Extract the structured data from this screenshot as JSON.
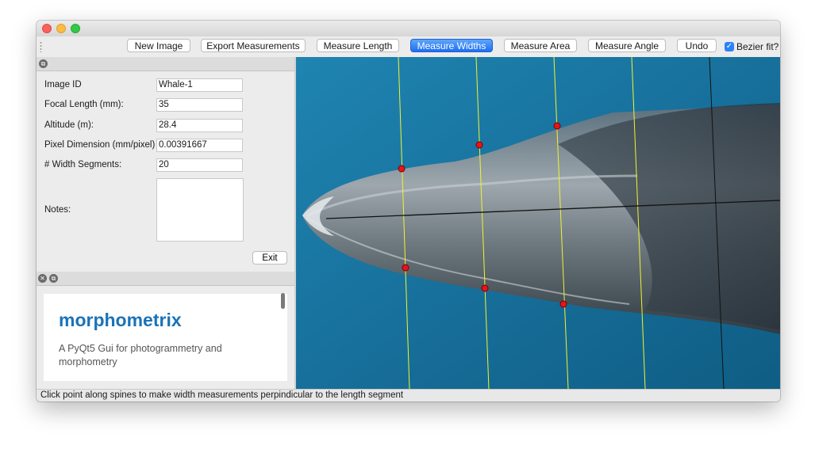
{
  "toolbar": {
    "buttons": [
      {
        "label": "New Image"
      },
      {
        "label": "Export Measurements"
      },
      {
        "label": "Measure Length"
      },
      {
        "label": "Measure Widths"
      },
      {
        "label": "Measure Area"
      },
      {
        "label": "Measure Angle"
      },
      {
        "label": "Undo"
      }
    ],
    "active_button": "Measure Widths",
    "bezier_label": "Bezier fit?",
    "bezier_checked": true
  },
  "form": {
    "image_id_label": "Image ID",
    "image_id_value": "Whale-1",
    "focal_length_label": "Focal Length (mm):",
    "focal_length_value": "35",
    "altitude_label": "Altitude (m):",
    "altitude_value": "28.4",
    "pixel_dim_label": "Pixel Dimension (mm/pixel)",
    "pixel_dim_value": "0.00391667",
    "width_segments_label": "# Width Segments:",
    "width_segments_value": "20",
    "notes_label": "Notes:",
    "notes_value": "",
    "exit_label": "Exit"
  },
  "docs": {
    "title": "morphometrix",
    "subtitle": "A PyQt5 Gui for photogrammetry and morphometry"
  },
  "status": {
    "message": "Click point along spines to make width measurements perpindicular to the length segment"
  },
  "colors": {
    "accent": "#2c7ff3",
    "water": "#1a6c96",
    "measure_line": "#f2f230",
    "point": "#e8141a",
    "spine": "#111111"
  }
}
